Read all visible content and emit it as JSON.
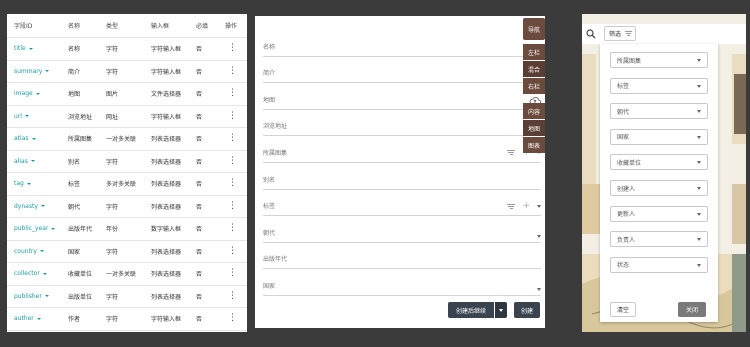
{
  "fields_table": {
    "headers": [
      "字段ID",
      "名称",
      "类型",
      "输入框",
      "必填",
      "操作"
    ],
    "rows": [
      {
        "id": "title",
        "name": "名称",
        "type": "字符",
        "input": "字符输入框",
        "required": "否"
      },
      {
        "id": "summary",
        "name": "简介",
        "type": "字符",
        "input": "字符输入框",
        "required": "否"
      },
      {
        "id": "image",
        "name": "地图",
        "type": "图片",
        "input": "文件选择器",
        "required": "否"
      },
      {
        "id": "url",
        "name": "浏览地址",
        "type": "网址",
        "input": "字符输入框",
        "required": "否"
      },
      {
        "id": "atlas",
        "name": "所属图集",
        "type": "一对多关联",
        "input": "列表选择器",
        "required": "否"
      },
      {
        "id": "alias",
        "name": "别名",
        "type": "字符",
        "input": "列表选择器",
        "required": "否"
      },
      {
        "id": "tag",
        "name": "标签",
        "type": "多对多关联",
        "input": "列表选择器",
        "required": "否"
      },
      {
        "id": "dynasty",
        "name": "朝代",
        "type": "字符",
        "input": "列表选择器",
        "required": "否"
      },
      {
        "id": "public_year",
        "name": "出版年代",
        "type": "年份",
        "input": "数字输入框",
        "required": "否"
      },
      {
        "id": "country",
        "name": "国家",
        "type": "字符",
        "input": "列表选择器",
        "required": "否"
      },
      {
        "id": "collector",
        "name": "收藏单位",
        "type": "一对多关联",
        "input": "列表选择器",
        "required": "否"
      },
      {
        "id": "publisher",
        "name": "出版单位",
        "type": "字符",
        "input": "列表选择器",
        "required": "否"
      },
      {
        "id": "author",
        "name": "作者",
        "type": "字符",
        "input": "字符输入框",
        "required": "否"
      }
    ]
  },
  "create_form": {
    "fields": [
      "名称",
      "简介",
      "地图",
      "浏览地址",
      "所属图集",
      "别名",
      "标签",
      "朝代",
      "出版年代",
      "国家"
    ],
    "create_continue_label": "创建后继续",
    "create_label": "创建",
    "side_nav": {
      "nav": "导航",
      "left": "左栏",
      "mixed": "混合",
      "right": "右栏",
      "content": "内容",
      "map": "地图",
      "chart": "图表"
    }
  },
  "filter_panel": {
    "filter_label": "筛选",
    "options": [
      "所属图集",
      "标签",
      "朝代",
      "国家",
      "收藏单位",
      "创建人",
      "更新人",
      "负责人",
      "状态"
    ],
    "clear_label": "清空",
    "close_label": "关闭"
  },
  "colors": {
    "teal_link": "#1a9ba3",
    "dark_button": "#3a4350",
    "brown_nav": "#6b4b3e",
    "close_button": "#7a7a7a"
  }
}
